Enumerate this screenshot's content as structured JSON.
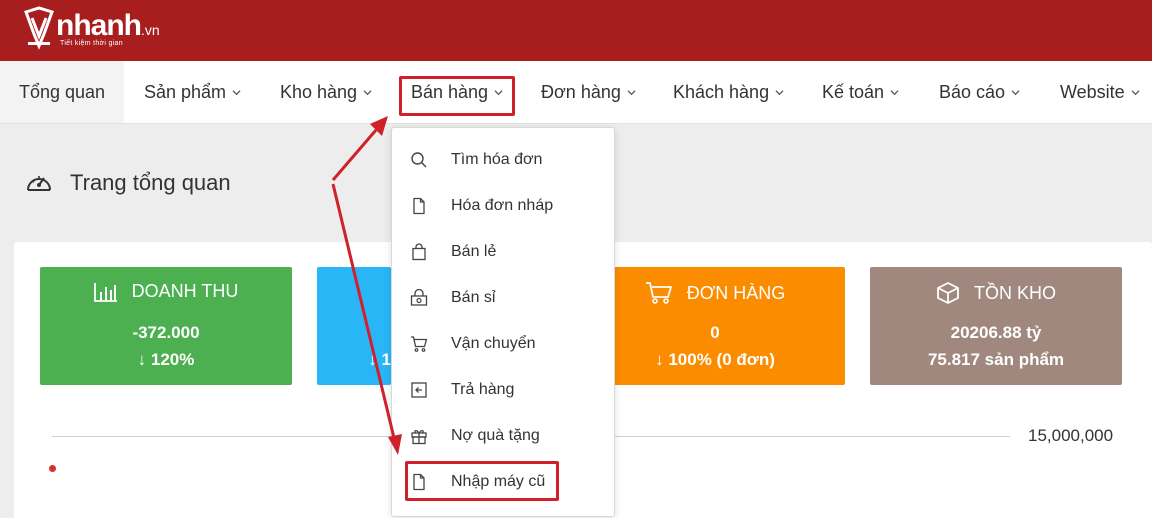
{
  "brand": {
    "name": "nhanh",
    "suffix": ".vn",
    "tagline": "Tiết kiệm thời gian",
    "color": "#a81d1e"
  },
  "nav": {
    "items": [
      {
        "label": "Tổng quan",
        "dropdown": false,
        "active": true
      },
      {
        "label": "Sản phẩm",
        "dropdown": true
      },
      {
        "label": "Kho hàng",
        "dropdown": true
      },
      {
        "label": "Bán hàng",
        "dropdown": true,
        "open": true
      },
      {
        "label": "Đơn hàng",
        "dropdown": true
      },
      {
        "label": "Khách hàng",
        "dropdown": true
      },
      {
        "label": "Kế toán",
        "dropdown": true
      },
      {
        "label": "Báo cáo",
        "dropdown": true
      },
      {
        "label": "Website",
        "dropdown": true
      }
    ]
  },
  "page": {
    "title": "Trang tổng quan",
    "icon": "dashboard-gauge-icon"
  },
  "stats": [
    {
      "title": "DOANH THU",
      "icon": "bar-chart-icon",
      "value": "-372.000",
      "change": "120%",
      "color": "#4caf50"
    },
    {
      "title": "",
      "icon": "",
      "value": "",
      "change": "1",
      "color": "#29b6f6"
    },
    {
      "title": "ĐƠN HÀNG",
      "icon": "cart-icon",
      "value": "0",
      "change": "100% (0 đơn)",
      "color": "#fb8c00"
    },
    {
      "title": "TỒN KHO",
      "icon": "box-icon",
      "value": "20206.88 tỷ",
      "change": "75.817 sản phẩm",
      "color": "#a1887f"
    }
  ],
  "chart": {
    "axis_label": "15,000,000"
  },
  "dropdown": {
    "items": [
      {
        "label": "Tìm hóa đơn",
        "icon": "search-icon"
      },
      {
        "label": "Hóa đơn nháp",
        "icon": "file-icon"
      },
      {
        "label": "Bán lẻ",
        "icon": "shopping-bag-icon"
      },
      {
        "label": "Bán sỉ",
        "icon": "wholesale-icon"
      },
      {
        "label": "Vận chuyển",
        "icon": "cart-icon"
      },
      {
        "label": "Trả hàng",
        "icon": "return-icon"
      },
      {
        "label": "Nợ quà tặng",
        "icon": "gift-icon"
      },
      {
        "label": "Nhập máy cũ",
        "icon": "file-icon",
        "highlighted": true
      }
    ]
  },
  "annotation": {
    "color": "#d0202a"
  }
}
